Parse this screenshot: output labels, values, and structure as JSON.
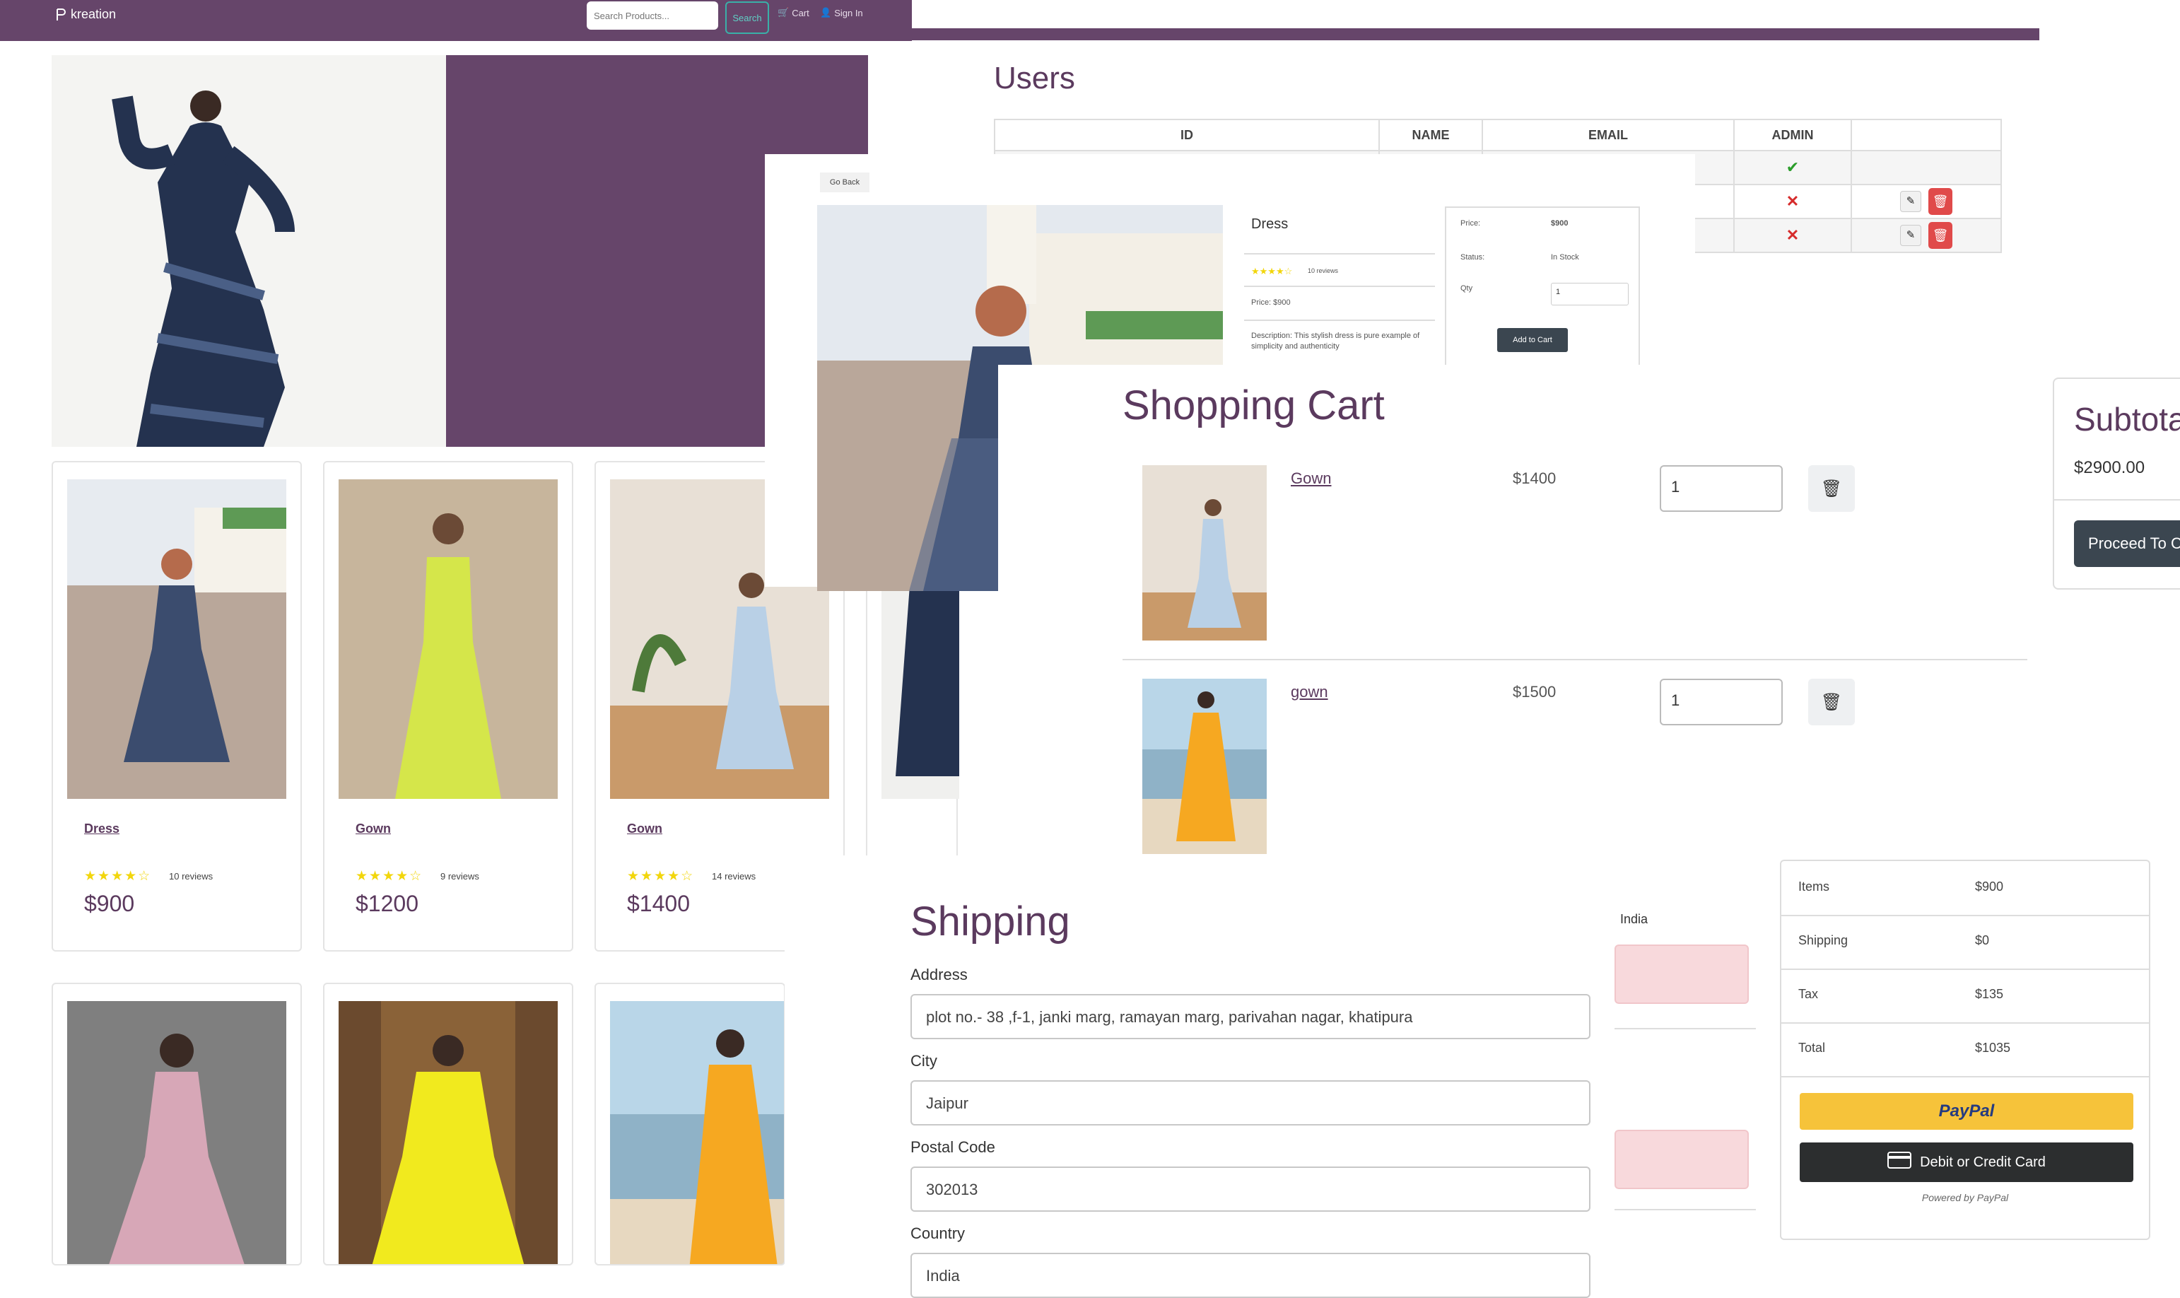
{
  "navbar": {
    "brand": "kreation",
    "search_placeholder": "Search Products...",
    "search_button": "Search",
    "cart_link": "Cart",
    "signin_link": "Sign In"
  },
  "products": [
    {
      "name": "Dress",
      "rating_stars": "★★★★☆",
      "reviews": "10 reviews",
      "price": "$900"
    },
    {
      "name": "Gown",
      "rating_stars": "★★★★☆",
      "reviews": "9 reviews",
      "price": "$1200"
    },
    {
      "name": "Gown",
      "rating_stars": "★★★★☆",
      "reviews": "14 reviews",
      "price": "$1400"
    }
  ],
  "users": {
    "title": "Users",
    "headers": [
      "ID",
      "NAME",
      "EMAIL",
      "ADMIN"
    ]
  },
  "product_detail": {
    "go_back": "Go Back",
    "title": "Dress",
    "rating_stars": "★★★★☆",
    "reviews": "10 reviews",
    "price_line": "Price: $900",
    "description": "Description: This stylish dress is pure example of simplicity and authenticity",
    "price_label": "Price:",
    "price_value": "$900",
    "status_label": "Status:",
    "status_value": "In Stock",
    "qty_label": "Qty",
    "qty_value": "1",
    "add_to_cart": "Add to Cart"
  },
  "cart": {
    "title": "Shopping Cart",
    "items": [
      {
        "name": "Gown",
        "price": "$1400",
        "qty": "1"
      },
      {
        "name": "gown",
        "price": "$1500",
        "qty": "1"
      }
    ]
  },
  "subtotal": {
    "title": "Subtotal",
    "amount": "$2900.00",
    "proceed": "Proceed To Checkout"
  },
  "shipping": {
    "title": "Shipping",
    "address_label": "Address",
    "address_value": "plot no.- 38 ,f-1, janki marg, ramayan marg, parivahan nagar, khatipura",
    "city_label": "City",
    "city_value": "Jaipur",
    "postal_label": "Postal Code",
    "postal_value": "302013",
    "country_label": "Country",
    "country_value": "India",
    "country_side": "India"
  },
  "summary": {
    "rows": [
      {
        "label": "Items",
        "value": "$900"
      },
      {
        "label": "Shipping",
        "value": "$0"
      },
      {
        "label": "Tax",
        "value": "$135"
      },
      {
        "label": "Total",
        "value": "$1035"
      }
    ],
    "paypal": "PayPal",
    "debit": "Debit or Credit Card",
    "powered": "Powered by PayPal"
  },
  "colors": {
    "brand": "#66456a",
    "accent_title": "#5b3a5e",
    "star": "#f2d60c",
    "danger": "#e04a4a",
    "paypal_yellow": "#f6c33a"
  },
  "icons": [
    "cart-icon",
    "user-icon",
    "check-icon",
    "cross-icon",
    "edit-icon",
    "trash-icon",
    "card-icon"
  ]
}
